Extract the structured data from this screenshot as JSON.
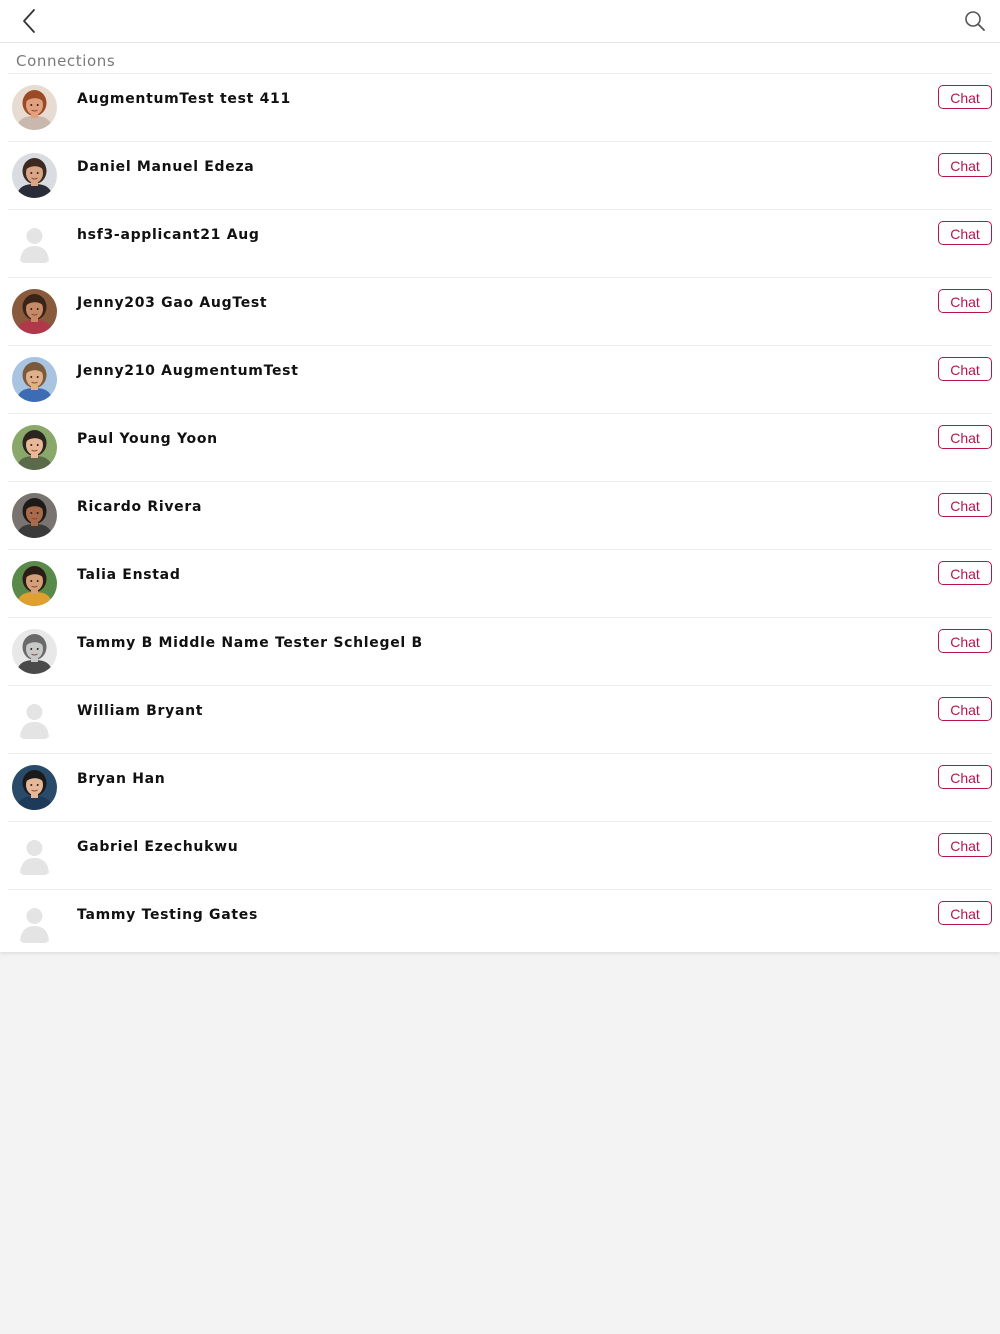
{
  "header": {
    "back_icon": "chevron-left-icon",
    "search_icon": "search-icon"
  },
  "section": {
    "title": "Connections"
  },
  "colors": {
    "accent": "#b5154e",
    "divider": "#ececec",
    "background": "#f3f3f3",
    "placeholder_avatar": "#e4e4e4"
  },
  "connections": [
    {
      "name": "AugmentumTest test 411",
      "chat_label": "Chat",
      "avatar": "photo",
      "skin": "#e2a07e",
      "hair": "#9a4a25",
      "bg": "#e8dcd2",
      "shirt": "#c8b8ae"
    },
    {
      "name": "Daniel Manuel Edeza",
      "chat_label": "Chat",
      "avatar": "photo",
      "skin": "#d9a585",
      "hair": "#3a2a22",
      "bg": "#d9dde2",
      "shirt": "#2a2d38"
    },
    {
      "name": "hsf3-applicant21 Aug",
      "chat_label": "Chat",
      "avatar": "placeholder"
    },
    {
      "name": "Jenny203 Gao AugTest",
      "chat_label": "Chat",
      "avatar": "photo",
      "skin": "#c68a66",
      "hair": "#3a2418",
      "bg": "#8a5a3c",
      "shirt": "#b0384a"
    },
    {
      "name": "Jenny210 AugmentumTest",
      "chat_label": "Chat",
      "avatar": "photo",
      "skin": "#e0b08a",
      "hair": "#7a5a3a",
      "bg": "#a8c4e0",
      "shirt": "#3c6cb4"
    },
    {
      "name": "Paul Young Yoon",
      "chat_label": "Chat",
      "avatar": "photo",
      "skin": "#e8b898",
      "hair": "#2a2520",
      "bg": "#8aa86a",
      "shirt": "#5a6a4a"
    },
    {
      "name": "Ricardo Rivera",
      "chat_label": "Chat",
      "avatar": "photo",
      "skin": "#a86a48",
      "hair": "#1e1a18",
      "bg": "#7a7470",
      "shirt": "#3a3a3a"
    },
    {
      "name": "Talia Enstad",
      "chat_label": "Chat",
      "avatar": "photo",
      "skin": "#d4a07a",
      "hair": "#2a1c16",
      "bg": "#5a8a4a",
      "shirt": "#e0a030"
    },
    {
      "name": "Tammy B Middle Name Tester Schlegel B",
      "chat_label": "Chat",
      "avatar": "photo",
      "skin": "#c8c8c8",
      "hair": "#6a6a6a",
      "bg": "#e8e8e8",
      "shirt": "#4a4a4a"
    },
    {
      "name": "William Bryant",
      "chat_label": "Chat",
      "avatar": "placeholder"
    },
    {
      "name": "Bryan Han",
      "chat_label": "Chat",
      "avatar": "photo",
      "skin": "#e6b898",
      "hair": "#1a1a1a",
      "bg": "#2a4a6a",
      "shirt": "#1e3a5a"
    },
    {
      "name": "Gabriel Ezechukwu",
      "chat_label": "Chat",
      "avatar": "placeholder"
    },
    {
      "name": "Tammy Testing Gates",
      "chat_label": "Chat",
      "avatar": "placeholder"
    }
  ]
}
